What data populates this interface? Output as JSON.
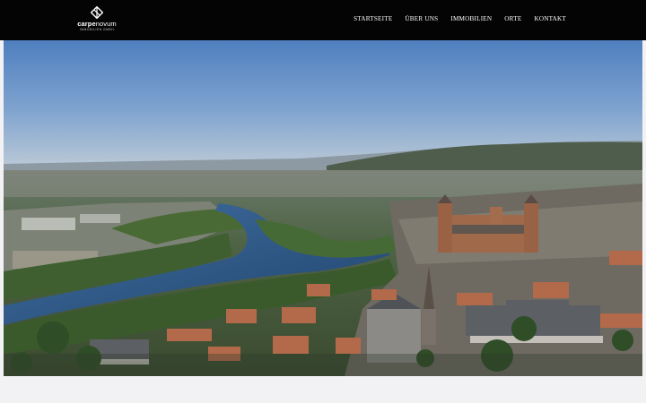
{
  "header": {
    "logo": {
      "word_bold": "carpe",
      "word_regular": "novum",
      "tagline": "IMMOBILIEN GMBH"
    },
    "nav": [
      {
        "label": "STARTSEITE"
      },
      {
        "label": "ÜBER UNS"
      },
      {
        "label": "IMMOBILIEN"
      },
      {
        "label": "ORTE"
      },
      {
        "label": "KONTAKT"
      }
    ]
  },
  "hero": {
    "image": "aerial-city-river-photo"
  },
  "colors": {
    "header_bg": "#040404",
    "nav_text": "#ffffff",
    "page_bg": "#f2f2f4"
  }
}
